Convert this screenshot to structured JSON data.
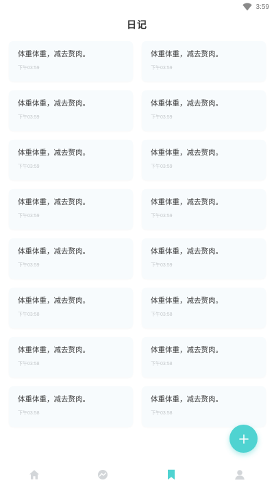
{
  "status_bar": {
    "time": "3:59",
    "wifi_icon": "wifi-icon"
  },
  "header": {
    "title": "日记"
  },
  "entries": [
    {
      "text": "体重体重，减去赘肉。",
      "time": "下午03:59"
    },
    {
      "text": "体重体重，减去赘肉。",
      "time": "下午03:59"
    },
    {
      "text": "体重体重，减去赘肉。",
      "time": "下午03:59"
    },
    {
      "text": "体重体重，减去赘肉。",
      "time": "下午03:59"
    },
    {
      "text": "体重体重，减去赘肉。",
      "time": "下午03:59"
    },
    {
      "text": "体重体重，减去赘肉。",
      "time": "下午03:59"
    },
    {
      "text": "体重体重，减去赘肉。",
      "time": "下午03:59"
    },
    {
      "text": "体重体重，减去赘肉。",
      "time": "下午03:59"
    },
    {
      "text": "体重体重，减去赘肉。",
      "time": "下午03:59"
    },
    {
      "text": "体重体重，减去赘肉。",
      "time": "下午03:59"
    },
    {
      "text": "体重体重，减去赘肉。",
      "time": "下午03:58"
    },
    {
      "text": "体重体重，减去赘肉。",
      "time": "下午03:58"
    },
    {
      "text": "体重体重，减去赘肉。",
      "time": "下午03:58"
    },
    {
      "text": "体重体重，减去赘肉。",
      "time": "下午03:58"
    },
    {
      "text": "体重体重，减去赘肉。",
      "time": "下午03:58"
    },
    {
      "text": "体重体重，减去赘肉。",
      "time": "下午03:58"
    }
  ],
  "fab": {
    "icon": "plus-icon",
    "color": "#4fd3d1"
  },
  "tabbar": {
    "items": [
      {
        "icon": "home-icon",
        "active": false
      },
      {
        "icon": "chart-icon",
        "active": false
      },
      {
        "icon": "bookmark-icon",
        "active": true
      },
      {
        "icon": "profile-icon",
        "active": false
      }
    ],
    "active_color": "#4fd3d1",
    "inactive_color": "#d3d6d9"
  }
}
